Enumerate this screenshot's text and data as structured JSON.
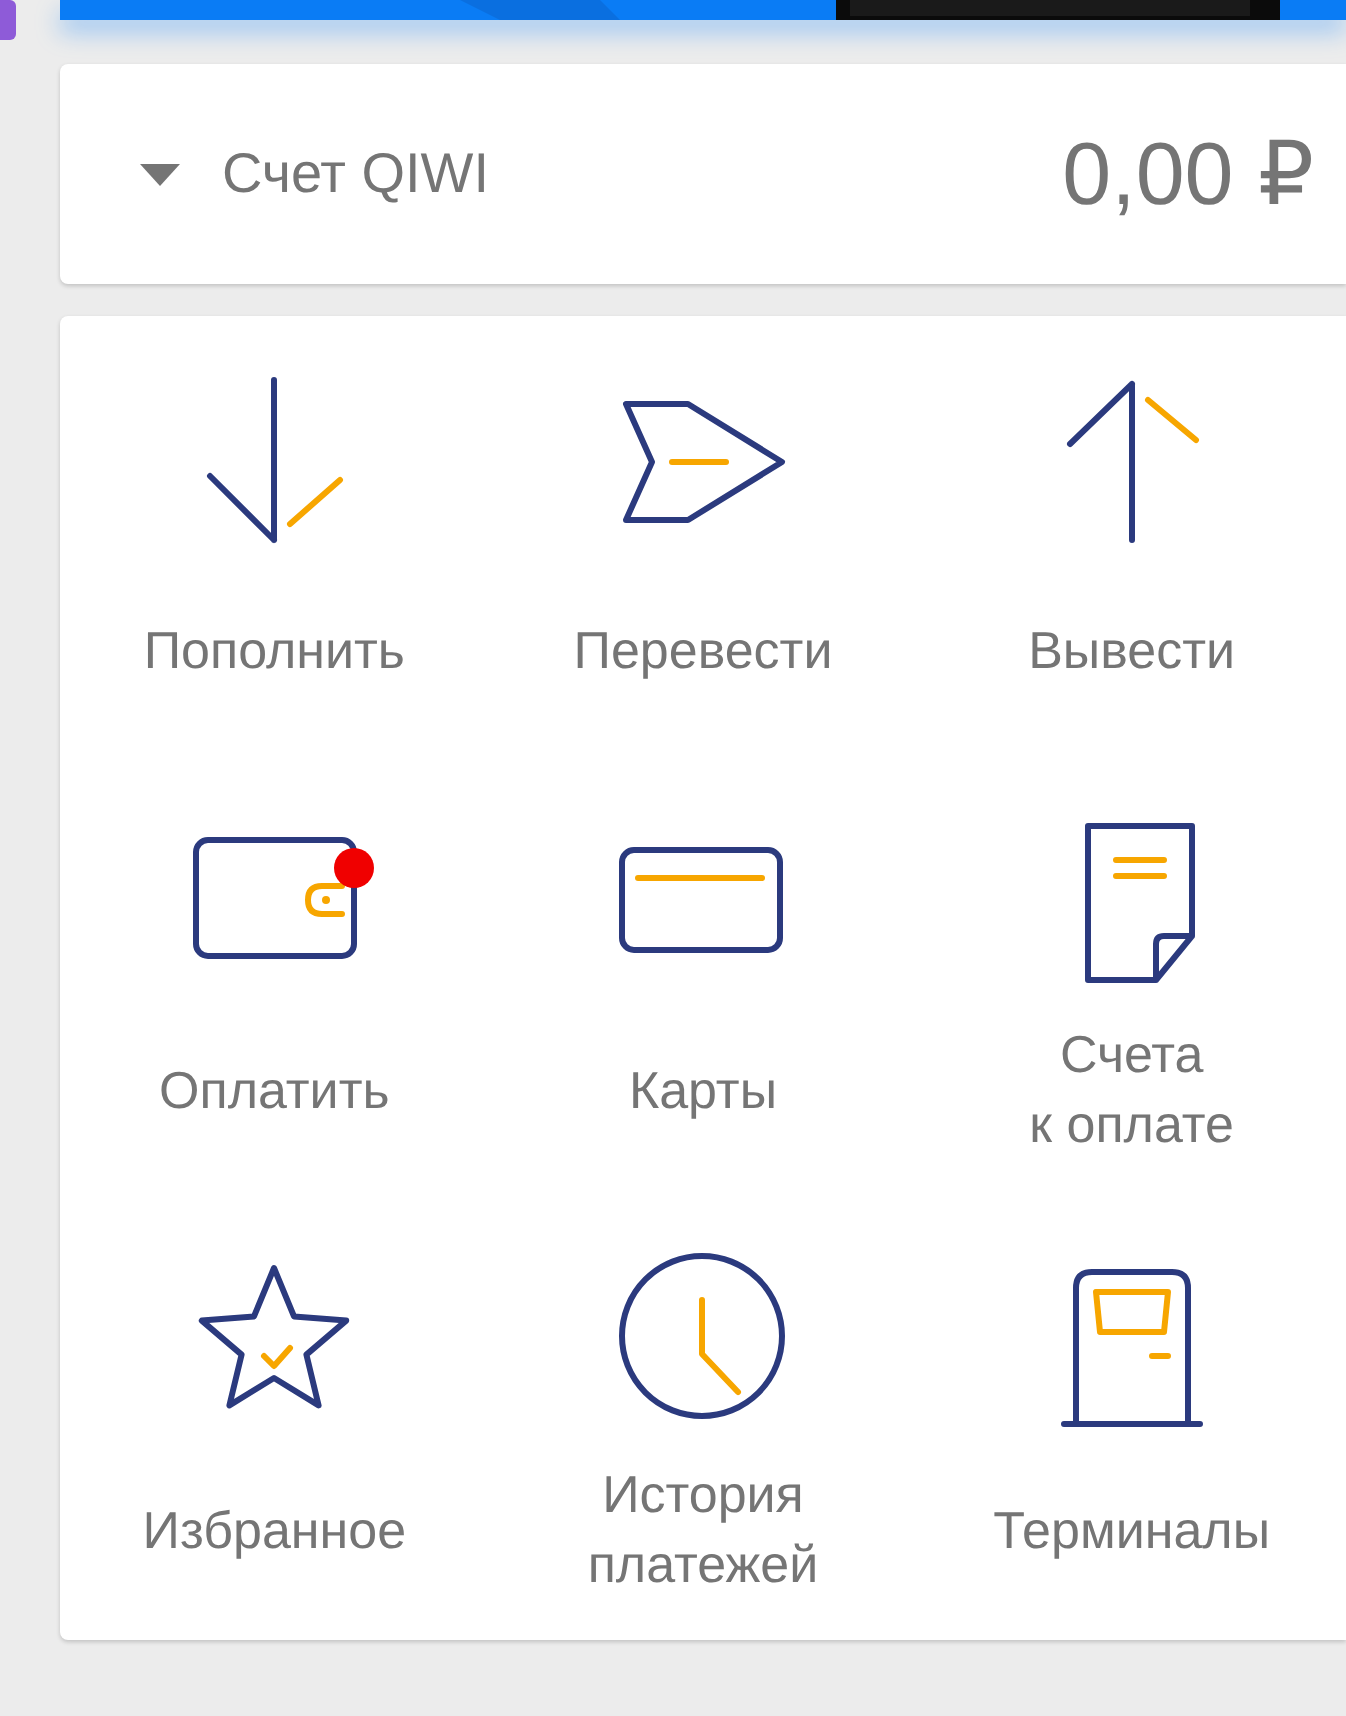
{
  "account": {
    "label": "Счет QIWI",
    "balance": "0,00 ₽"
  },
  "actions": [
    {
      "label": "Пополнить",
      "notification": false
    },
    {
      "label": "Перевести",
      "notification": false
    },
    {
      "label": "Вывести",
      "notification": false
    },
    {
      "label": "Оплатить",
      "notification": true
    },
    {
      "label": "Карты",
      "notification": false
    },
    {
      "label": "Счета\nк оплате",
      "notification": false
    },
    {
      "label": "Избранное",
      "notification": false
    },
    {
      "label": "История\nплатежей",
      "notification": false
    },
    {
      "label": "Терминалы",
      "notification": false
    }
  ]
}
